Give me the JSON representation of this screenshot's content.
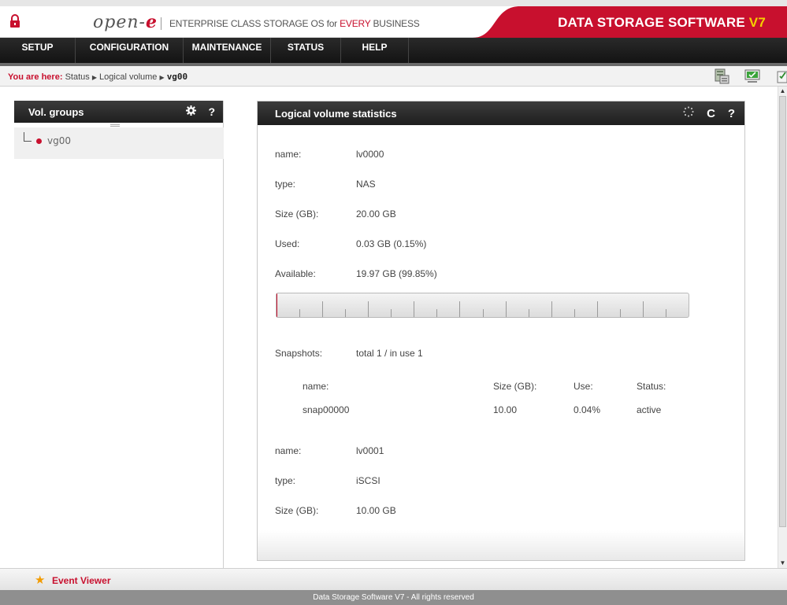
{
  "header": {
    "logo_text": "open-",
    "logo_e": "e",
    "tagline_pre": "ENTERPRISE CLASS STORAGE OS for ",
    "tagline_hl": "EVERY",
    "tagline_post": " BUSINESS",
    "brand": "DATA STORAGE SOFTWARE ",
    "brand_version": "V7",
    "accent_color": "#c8102e"
  },
  "nav": {
    "items": [
      {
        "label": "SETUP"
      },
      {
        "label": "CONFIGURATION"
      },
      {
        "label": "MAINTENANCE"
      },
      {
        "label": "STATUS"
      },
      {
        "label": "HELP"
      }
    ]
  },
  "breadcrumb": {
    "label": "You are here:",
    "path_1": "Status",
    "path_2": "Logical volume",
    "current": "vg00",
    "separator": "▶"
  },
  "toolbar_icons": [
    "server-icon",
    "monitor-check-icon",
    "checklist-icon"
  ],
  "left_panel": {
    "title": "Vol. groups",
    "settings_icon": "gear-icon",
    "help_label": "?",
    "tree": [
      {
        "label": "vg00",
        "status_color": "#c8102e"
      }
    ]
  },
  "main_panel": {
    "title": "Logical volume statistics",
    "refresh_label": "C",
    "help_label": "?",
    "volume_1": {
      "name_label": "name:",
      "name": "lv0000",
      "type_label": "type:",
      "type": "NAS",
      "size_label": "Size (GB):",
      "size": "20.00 GB",
      "used_label": "Used:",
      "used": "0.03 GB (0.15%)",
      "available_label": "Available:",
      "available": "19.97 GB (99.85%)",
      "used_fraction": 0.0015
    },
    "snapshots": {
      "label": "Snapshots:",
      "summary": "total 1 / in use 1",
      "headers": {
        "name": "name:",
        "size": "Size (GB):",
        "use": "Use:",
        "status": "Status:"
      },
      "rows": [
        {
          "name": "snap00000",
          "size": "10.00",
          "use": "0.04%",
          "status": "active"
        }
      ]
    },
    "volume_2": {
      "name_label": "name:",
      "name": "lv0001",
      "type_label": "type:",
      "type": "iSCSI",
      "size_label": "Size (GB):",
      "size": "10.00 GB"
    }
  },
  "event_viewer": {
    "label": "Event Viewer"
  },
  "footer": {
    "text": "Data Storage Software V7 - All rights reserved"
  }
}
